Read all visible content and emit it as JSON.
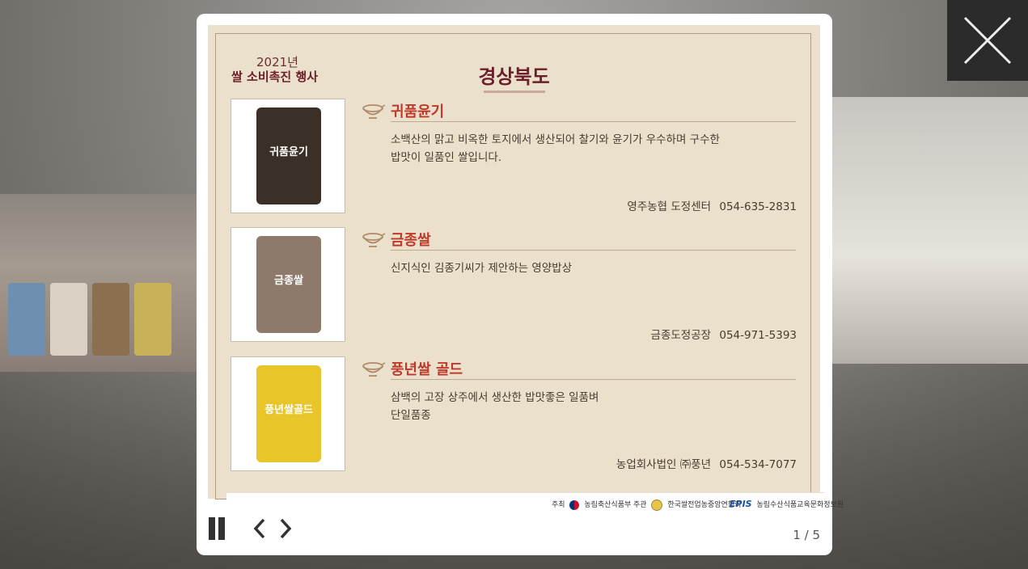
{
  "viewer": {
    "close_icon": "close-icon",
    "pager": "1 / 5",
    "pause_icon": "pause-icon",
    "prev_icon": "chevron-left-icon",
    "next_icon": "chevron-right-icon"
  },
  "poster": {
    "year": "2021년",
    "event": "쌀 소비촉진 행사",
    "region": "경상북도",
    "products": [
      {
        "name": "귀품윤기",
        "desc_lines": [
          "소백산의 맑고 비옥한 토지에서 생산되어 찰기와 윤기가 우수하며 구수한",
          "밥맛이 일품인 쌀입니다."
        ],
        "seller": "영주농협 도정센터",
        "phone": "054-635-2831",
        "bag_label": "귀품윤기",
        "bag_color": "#3b3028"
      },
      {
        "name": "금종쌀",
        "desc_lines": [
          "신지식인 김종기씨가 제안하는 영양밥상",
          ""
        ],
        "seller": "금종도정공장",
        "phone": "054-971-5393",
        "bag_label": "금종쌀",
        "bag_color": "#8d7a6a"
      },
      {
        "name": "풍년쌀 골드",
        "desc_lines": [
          "삼백의 고장 상주에서 생산한 밥맛좋은 일품벼",
          "단일품종"
        ],
        "seller": "농업회사법인 ㈜풍년",
        "phone": "054-534-7077",
        "bag_label": "풍년쌀골드",
        "bag_color": "#e8c62a"
      }
    ],
    "sponsors": {
      "host_label": "주최",
      "host_name": "농림축산식품부",
      "org_label": "주관",
      "org_name": "한국쌀전업농중앙연합회",
      "epis_mark": "EPIS",
      "epis_name": "농림수산식품교육문화정보원"
    }
  },
  "colors": {
    "poster_bg": "#ebe0cc",
    "title": "#6b1f2a",
    "product_name": "#c0392b"
  }
}
